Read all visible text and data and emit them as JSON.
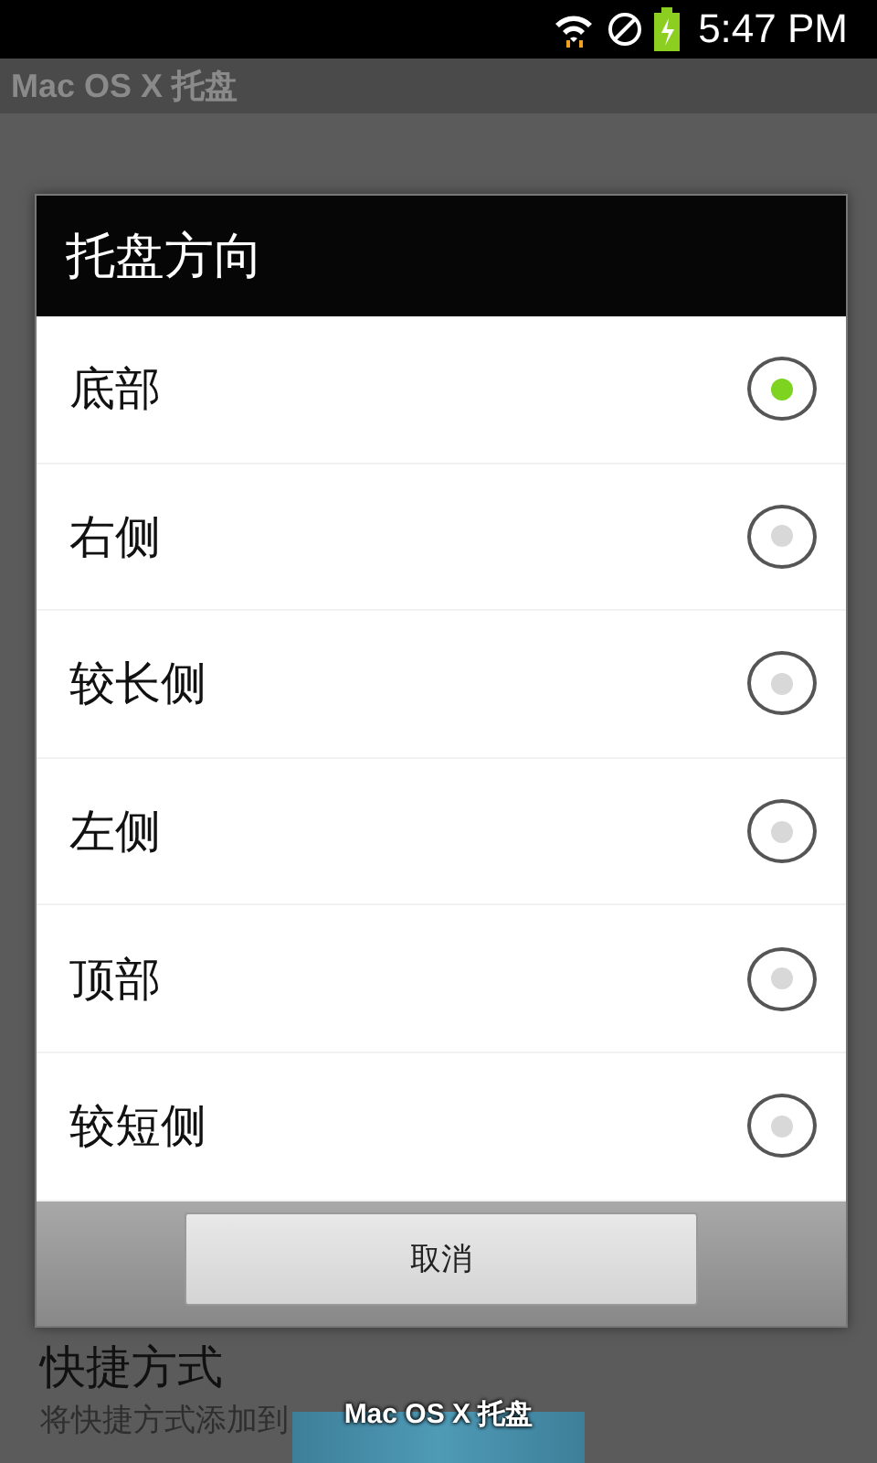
{
  "status_bar": {
    "time": "5:47 PM"
  },
  "app_bar": {
    "title": "Mac OS X 托盘"
  },
  "settings": [
    {
      "title": "快捷方式",
      "summary": "将快捷方式添加到"
    }
  ],
  "dialog": {
    "title": "托盘方向",
    "options": [
      {
        "label": "底部",
        "selected": true
      },
      {
        "label": "右侧",
        "selected": false
      },
      {
        "label": "较长侧",
        "selected": false
      },
      {
        "label": "左侧",
        "selected": false
      },
      {
        "label": "顶部",
        "selected": false
      },
      {
        "label": "较短侧",
        "selected": false
      }
    ],
    "cancel": "取消"
  },
  "tray": {
    "label": "Mac OS X 托盘"
  }
}
